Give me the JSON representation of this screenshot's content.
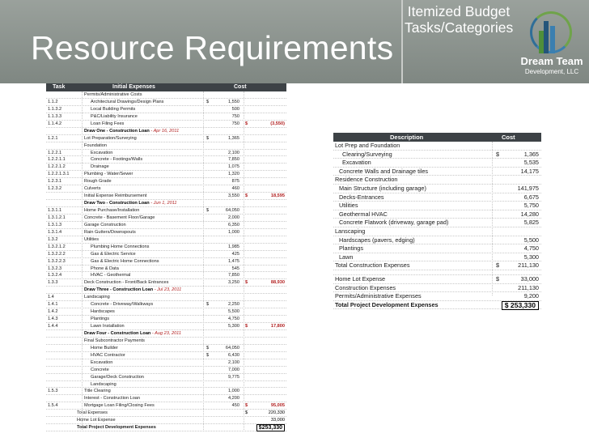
{
  "header": {
    "title": "Resource Requirements",
    "subtitle": "Itemized Budget Tasks/Categories",
    "logo_name": "Dream Team",
    "logo_sub": "Development, LLC"
  },
  "left_table": {
    "headers": {
      "task": "Task",
      "expenses": "Initial Expenses",
      "cost": "Cost"
    },
    "rows": [
      {
        "task": "",
        "exp": "Permits/Administrative Costs",
        "cls": "",
        "ind": 0
      },
      {
        "task": "1.1.2",
        "exp": "Architectural Drawings/Design Plans",
        "dol": "$",
        "amt": "1,550",
        "ind": 1
      },
      {
        "task": "1.1.3.2",
        "exp": "Local Building Permits",
        "amt": "500",
        "ind": 1
      },
      {
        "task": "1.1.3.3",
        "exp": "P&C/Liability Insurance",
        "amt": "750",
        "ind": 1
      },
      {
        "task": "1.1.4.2",
        "exp": "Loan Filing Fees",
        "amt": "750",
        "dol2": "$",
        "tot": "(3,550)",
        "ind": 1
      },
      {
        "task": "",
        "exp": "Draw One - Construction Loan",
        "sub": " - Apr 16, 2011",
        "cls": "sect"
      },
      {
        "task": "1.2.1",
        "exp": "Lot Preparation/Surveying",
        "dol": "$",
        "amt": "1,365",
        "ind": 0
      },
      {
        "task": "",
        "exp": "Foundation",
        "ind": 0
      },
      {
        "task": "1.2.2.1",
        "exp": "Excavation",
        "amt": "2,100",
        "ind": 1
      },
      {
        "task": "1.2.2.1.1",
        "exp": "Concrete - Footings/Walls",
        "amt": "7,850",
        "ind": 1
      },
      {
        "task": "1.2.2.1.2",
        "exp": "Drainage",
        "amt": "1,075",
        "ind": 1
      },
      {
        "task": "1.2.2.1.3.1",
        "exp": "Plumbing - Water/Sewer",
        "amt": "1,320",
        "ind": 0
      },
      {
        "task": "1.2.3.1",
        "exp": "Rough Grade",
        "amt": "875",
        "ind": 0
      },
      {
        "task": "1.2.3.2",
        "exp": "Culverts",
        "amt": "460",
        "ind": 0
      },
      {
        "task": "",
        "exp": "Initial Expense Reimbursement",
        "amt": "3,550",
        "dol2": "$",
        "tot": "18,595",
        "ind": 0
      },
      {
        "task": "",
        "exp": "Draw Two - Construction Loan",
        "sub": " - Jun 1, 2011",
        "cls": "sect"
      },
      {
        "task": "1.3.1.1",
        "exp": "Home Purchase/Installation",
        "dol": "$",
        "amt": "64,050",
        "ind": 0
      },
      {
        "task": "1.3.1.2.1",
        "exp": "Concrete - Basement Floor/Garage",
        "amt": "2,000",
        "ind": 0
      },
      {
        "task": "1.3.1.3",
        "exp": "Garage Construction",
        "amt": "6,350",
        "ind": 0
      },
      {
        "task": "1.3.1.4",
        "exp": "Rain Gutters/Downspouts",
        "amt": "1,000",
        "ind": 0
      },
      {
        "task": "1.3.2",
        "exp": "Utilities",
        "ind": 0
      },
      {
        "task": "1.3.2.1.2",
        "exp": "Plumbing Home Connections",
        "amt": "1,985",
        "ind": 1
      },
      {
        "task": "1.3.2.2.2",
        "exp": "Gas & Electric Service",
        "amt": "425",
        "ind": 1
      },
      {
        "task": "1.3.2.2.3",
        "exp": "Gas & Electric Home Connections",
        "amt": "1,475",
        "ind": 1
      },
      {
        "task": "1.3.2.3",
        "exp": "Phone & Data",
        "amt": "545",
        "ind": 1
      },
      {
        "task": "1.3.2.4",
        "exp": "HVAC - Geothermal",
        "amt": "7,850",
        "ind": 1
      },
      {
        "task": "1.3.3",
        "exp": "Deck Construction - Front/Back Entrances",
        "amt": "3,250",
        "dol2": "$",
        "tot": "88,930",
        "ind": 0
      },
      {
        "task": "",
        "exp": "Draw Three - Construction Loan",
        "sub": " - Jul 23, 2011",
        "cls": "sect"
      },
      {
        "task": "1.4",
        "exp": "Landscaping",
        "ind": 0
      },
      {
        "task": "1.4.1",
        "exp": "Concrete - Driveway/Walkways",
        "dol": "$",
        "amt": "2,250",
        "ind": 1
      },
      {
        "task": "1.4.2",
        "exp": "Hardscapes",
        "amt": "5,500",
        "ind": 1
      },
      {
        "task": "1.4.3",
        "exp": "Plantings",
        "amt": "4,750",
        "ind": 1
      },
      {
        "task": "1.4.4",
        "exp": "Lawn Installation",
        "amt": "5,300",
        "dol2": "$",
        "tot": "17,800",
        "ind": 1
      },
      {
        "task": "",
        "exp": "Draw Four - Construction Loan",
        "sub": " - Aug 23, 2011",
        "cls": "sect"
      },
      {
        "task": "",
        "exp": "Final Subcontractor Payments",
        "ind": 0
      },
      {
        "task": "",
        "exp": "Home Builder",
        "dol": "$",
        "amt": "64,050",
        "ind": 1
      },
      {
        "task": "",
        "exp": "HVAC Contractor",
        "dol": "$",
        "amt": "6,430",
        "ind": 1
      },
      {
        "task": "",
        "exp": "Excavation",
        "amt": "2,100",
        "ind": 1
      },
      {
        "task": "",
        "exp": "Concrete",
        "amt": "7,000",
        "ind": 1
      },
      {
        "task": "",
        "exp": "Garage/Deck Construction",
        "amt": "9,775",
        "ind": 1
      },
      {
        "task": "",
        "exp": "Landscaping",
        "ind": 1
      },
      {
        "task": "1.5.3",
        "exp": "Title Clearing",
        "amt": "1,000",
        "ind": 0
      },
      {
        "task": "",
        "exp": "Interest - Construction Loan",
        "amt": "4,200",
        "ind": 0
      },
      {
        "task": "1.5.4",
        "exp": "Mortgage Loan Filing/Closing Fees",
        "amt": "450",
        "dol2": "$",
        "tot": "95,005",
        "ind": 0
      }
    ],
    "summary": [
      {
        "label": "Total Expenses",
        "dol": "$",
        "tot": "220,330"
      },
      {
        "label": "Home Lot Expense",
        "tot": "33,000"
      },
      {
        "label": "Total Project Development Expenses",
        "tot": "$253,330",
        "fin": true
      }
    ]
  },
  "right_table": {
    "headers": {
      "desc": "Description",
      "cost": "Cost"
    },
    "rows": [
      {
        "desc": "Lot Prep and Foundation",
        "ind": 0
      },
      {
        "desc": "Clearing/Surveying",
        "dol": "$",
        "amt": "1,365",
        "ind": 2
      },
      {
        "desc": "Excavation",
        "amt": "5,535",
        "ind": 2
      },
      {
        "desc": "Concrete Walls and Drainage tiles",
        "amt": "14,175",
        "ind": 1
      },
      {
        "desc": "Residence Construction",
        "ind": 0
      },
      {
        "desc": "Main Structure (including garage)",
        "amt": "141,975",
        "ind": 1
      },
      {
        "desc": "Decks-Entrances",
        "amt": "6,675",
        "ind": 1
      },
      {
        "desc": "Utilities",
        "amt": "5,750",
        "ind": 1
      },
      {
        "desc": "Geothermal HVAC",
        "amt": "14,280",
        "ind": 1
      },
      {
        "desc": "Concrete Flatwork (driveway, garage pad)",
        "amt": "5,825",
        "ind": 1
      },
      {
        "desc": "Lanscaping",
        "ind": 0
      },
      {
        "desc": "Hardscapes (pavers, edging)",
        "amt": "5,500",
        "ind": 1
      },
      {
        "desc": "Plantings",
        "amt": "4,750",
        "ind": 1
      },
      {
        "desc": "Lawn",
        "amt": "5,300",
        "ind": 1
      },
      {
        "desc": "Total Construction Expenses",
        "dol": "$",
        "amt": "211,130",
        "ind": 0
      }
    ],
    "summary": [
      {
        "desc": "Home Lot Expense",
        "dol": "$",
        "amt": "33,000"
      },
      {
        "desc": "Construction Expenses",
        "amt": "211,130"
      },
      {
        "desc": "Permits/Administrative Expenses",
        "amt": "9,200"
      },
      {
        "desc": "Total Project Development Expenses",
        "amt": "$ 253,330",
        "tot": true
      }
    ]
  }
}
